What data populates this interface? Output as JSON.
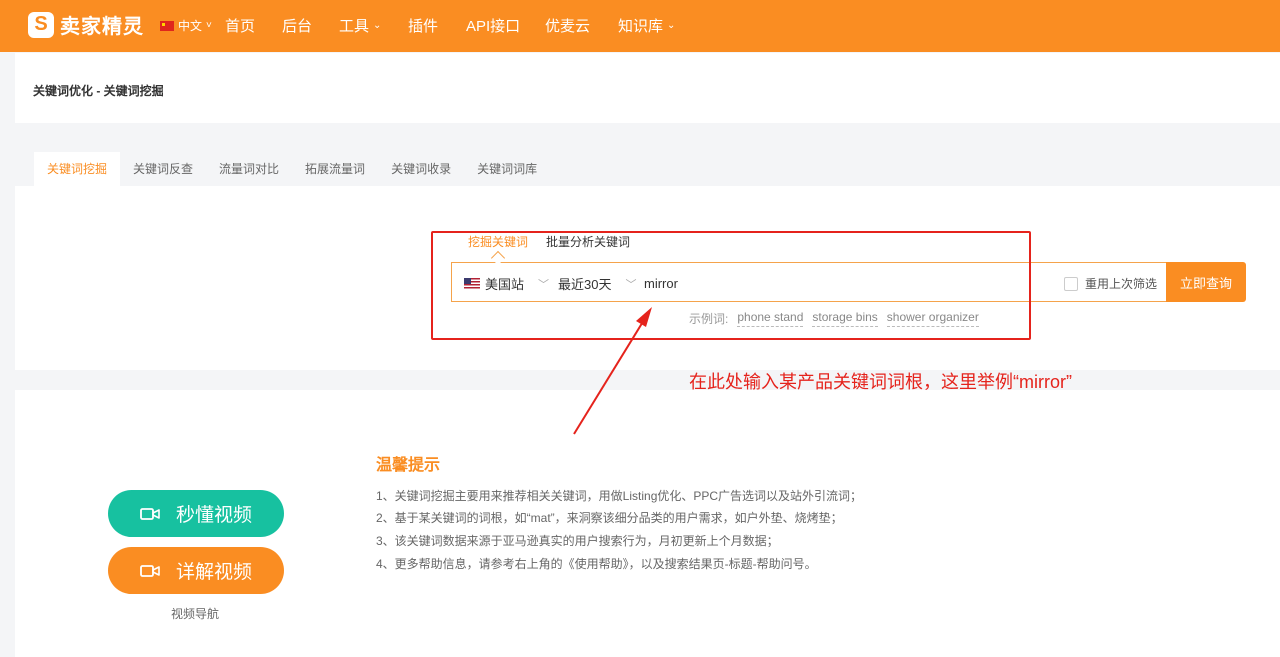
{
  "header": {
    "logo_text": "卖家精灵",
    "logo_mark": "S",
    "lang": "中文",
    "nav": [
      {
        "label": "首页",
        "dropdown": false
      },
      {
        "label": "后台",
        "dropdown": false
      },
      {
        "label": "工具",
        "dropdown": true
      },
      {
        "label": "插件",
        "dropdown": false
      },
      {
        "label": "API接口",
        "dropdown": false
      },
      {
        "label": "优麦云",
        "dropdown": false
      },
      {
        "label": "知识库",
        "dropdown": true
      }
    ]
  },
  "breadcrumb": "关键词优化 - 关键词挖掘",
  "tabs": [
    {
      "label": "关键词挖掘",
      "active": true
    },
    {
      "label": "关键词反查",
      "active": false
    },
    {
      "label": "流量词对比",
      "active": false
    },
    {
      "label": "拓展流量词",
      "active": false
    },
    {
      "label": "关键词收录",
      "active": false
    },
    {
      "label": "关键词词库",
      "active": false
    }
  ],
  "search": {
    "subtabs": [
      {
        "label": "挖掘关键词",
        "active": true
      },
      {
        "label": "批量分析关键词",
        "active": false
      }
    ],
    "site": "美国站",
    "range": "最近30天",
    "keyword_value": "mirror",
    "reuse_label": "重用上次筛选",
    "button": "立即查询",
    "examples_label": "示例词:",
    "examples": [
      "phone stand",
      "storage bins",
      "shower organizer"
    ]
  },
  "annotation": {
    "text": "在此处输入某产品关键词词根，这里举例“mirror”",
    "color": "#e5231c"
  },
  "video": {
    "quick": "秒懂视频",
    "detail": "详解视频",
    "nav_label": "视频导航"
  },
  "tips": {
    "title": "温馨提示",
    "items": [
      "1、关键词挖掘主要用来推荐相关关键词，用做Listing优化、PPC广告选词以及站外引流词；",
      "2、基于某关键词的词根，如“mat”，来洞察该细分品类的用户需求，如户外垫、烧烤垫；",
      "3、该关键词数据来源于亚马逊真实的用户搜索行为，月初更新上个月数据；",
      "4、更多帮助信息，请参考右上角的《使用帮助》，以及搜索结果页-标题-帮助问号。"
    ]
  },
  "colors": {
    "brand": "#fa8d22",
    "green": "#17c1a0",
    "annotation": "#e5231c"
  }
}
